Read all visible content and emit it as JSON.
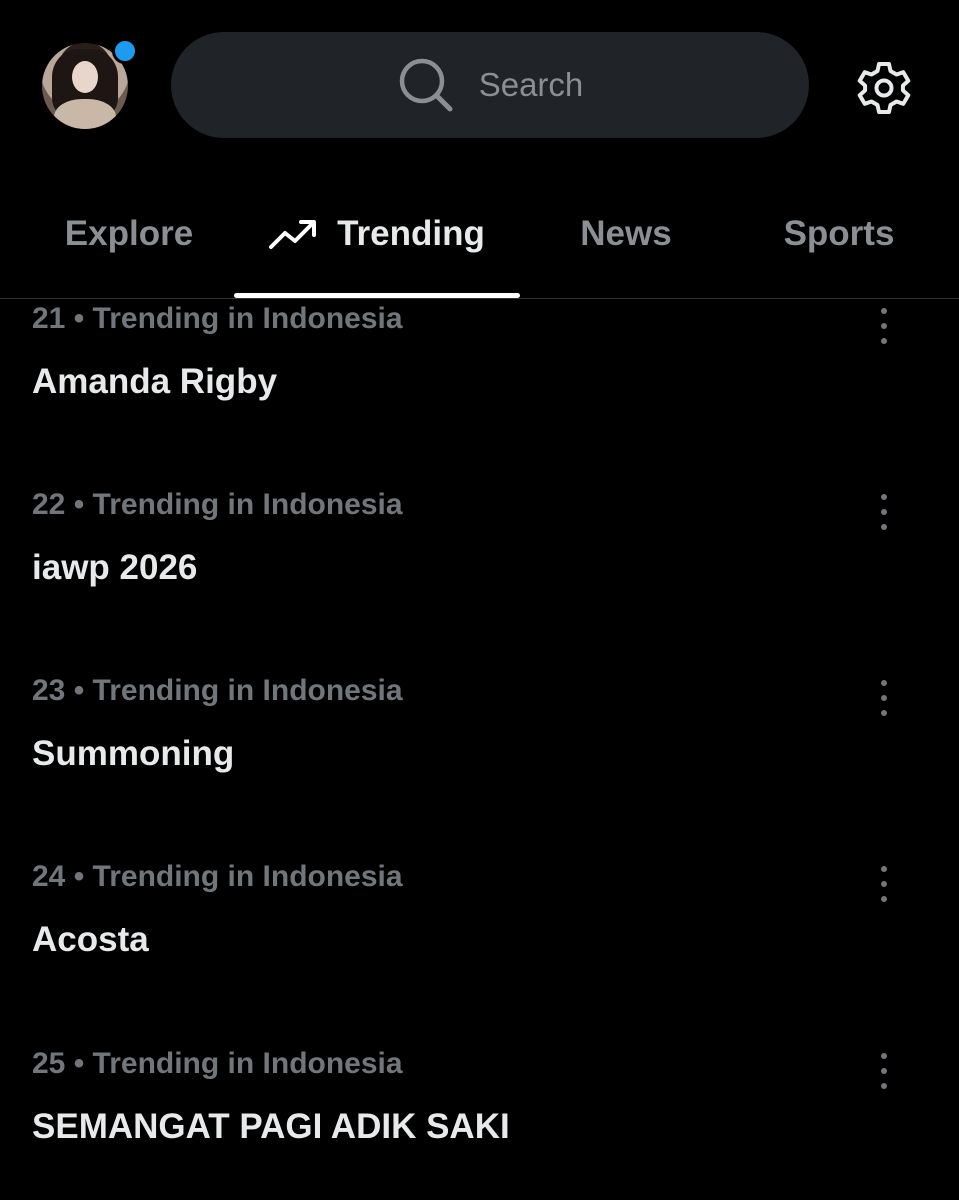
{
  "search": {
    "placeholder": "Search"
  },
  "tabs": [
    {
      "label": "Explore"
    },
    {
      "label": "Trending",
      "active": true
    },
    {
      "label": "News"
    },
    {
      "label": "Sports"
    }
  ],
  "trends": [
    {
      "rank": "21",
      "context": "Trending in Indonesia",
      "meta": "21 • Trending in Indonesia",
      "title": "Amanda Rigby"
    },
    {
      "rank": "22",
      "context": "Trending in Indonesia",
      "meta": "22 • Trending in Indonesia",
      "title": "iawp 2026"
    },
    {
      "rank": "23",
      "context": "Trending in Indonesia",
      "meta": "23 • Trending in Indonesia",
      "title": "Summoning"
    },
    {
      "rank": "24",
      "context": "Trending in Indonesia",
      "meta": "24 • Trending in Indonesia",
      "title": "Acosta"
    },
    {
      "rank": "25",
      "context": "Trending in Indonesia",
      "meta": "25 • Trending in Indonesia",
      "title": "SEMANGAT PAGI ADIK SAKI"
    }
  ],
  "icons": {
    "search": "search-icon",
    "settings": "gear-icon",
    "trending": "trending-arrow-icon",
    "more": "more-vertical-icon"
  },
  "colors": {
    "background": "#000000",
    "accent": "#1d9bf0",
    "primary_text": "#e7e9ea",
    "secondary_text": "#71767b",
    "search_bg": "#202327"
  }
}
